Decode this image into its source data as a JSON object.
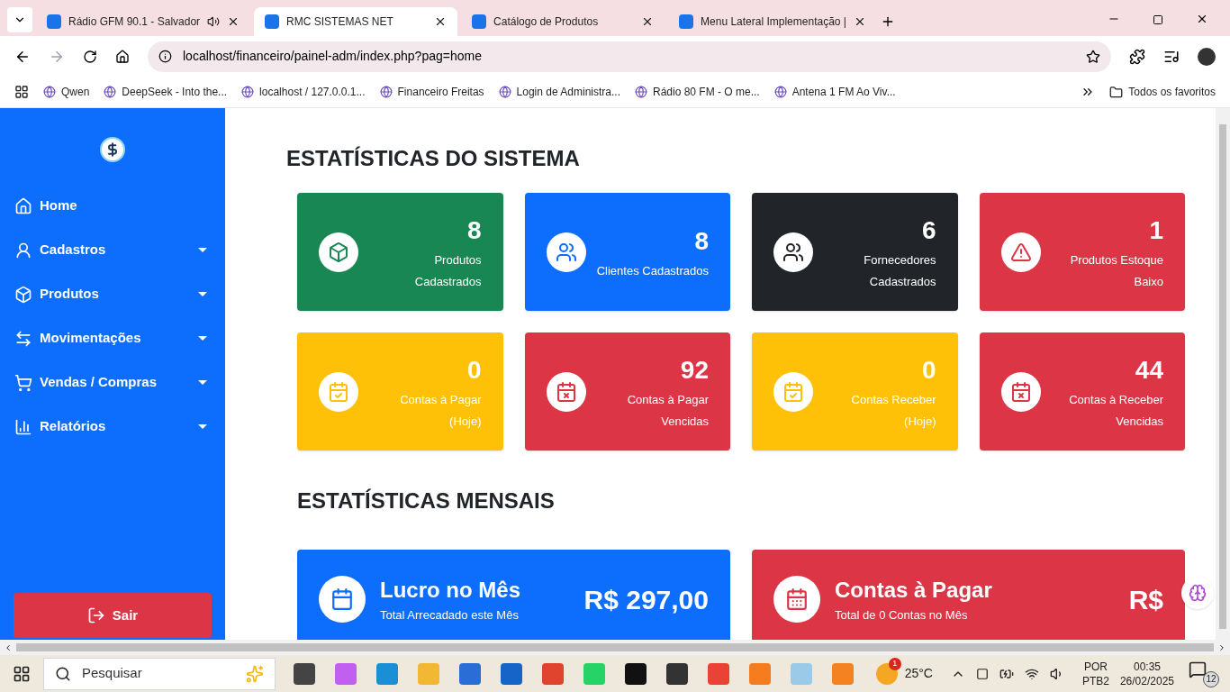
{
  "browser": {
    "tabs": [
      {
        "title": "Rádio GFM 90.1 - Salvador",
        "selected": false,
        "audio": true
      },
      {
        "title": "RMC SISTEMAS NET",
        "selected": true,
        "audio": false
      },
      {
        "title": "Catálogo de Produtos",
        "selected": false,
        "audio": false
      },
      {
        "title": "Menu Lateral Implementação |",
        "selected": false,
        "audio": false
      }
    ],
    "address": "localhost/financeiro/painel-adm/index.php?pag=home",
    "bookmarks": [
      "Qwen",
      "DeepSeek - Into the...",
      "localhost / 127.0.0.1...",
      "Financeiro Freitas",
      "Login de Administra...",
      "Rádio 80 FM - O me...",
      "Antena 1 FM Ao Viv..."
    ],
    "all_bookmarks": "Todos os favoritos"
  },
  "sidebar": {
    "items": [
      {
        "label": "Home",
        "kind": "home",
        "has_submenu": false
      },
      {
        "label": "Cadastros",
        "kind": "users",
        "has_submenu": true
      },
      {
        "label": "Produtos",
        "kind": "box",
        "has_submenu": true
      },
      {
        "label": "Movimentações",
        "kind": "arrows",
        "has_submenu": true
      },
      {
        "label": "Vendas / Compras",
        "kind": "cart",
        "has_submenu": true
      },
      {
        "label": "Relatórios",
        "kind": "chart",
        "has_submenu": true
      }
    ],
    "logout": "Sair"
  },
  "stats": {
    "title": "ESTATÍSTICAS DO SISTEMA",
    "cards": [
      {
        "value": "8",
        "label": "Produtos Cadastrados",
        "color": "#198754",
        "kind": "box"
      },
      {
        "value": "8",
        "label": "Clientes Cadastrados",
        "color": "#0d6efd",
        "kind": "users"
      },
      {
        "value": "6",
        "label": "Fornecedores Cadastrados",
        "color": "#212529",
        "kind": "users"
      },
      {
        "value": "1",
        "label": "Produtos Estoque Baixo",
        "color": "#dc3545",
        "kind": "alert"
      },
      {
        "value": "0",
        "label": "Contas à Pagar (Hoje)",
        "color": "#ffc107",
        "kind": "calendar-check"
      },
      {
        "value": "92",
        "label": "Contas à Pagar Vencidas",
        "color": "#dc3545",
        "kind": "calendar-x"
      },
      {
        "value": "0",
        "label": "Contas Receber (Hoje)",
        "color": "#ffc107",
        "kind": "calendar-check"
      },
      {
        "value": "44",
        "label": "Contas à Receber Vencidas",
        "color": "#dc3545",
        "kind": "calendar-x"
      }
    ]
  },
  "monthly": {
    "title": "ESTATÍSTICAS MENSAIS",
    "cards": [
      {
        "title": "Lucro no Mês",
        "subtitle": "Total Arrecadado este Mês",
        "value": "R$ 297,00",
        "color": "#0d6efd",
        "kind": "calendar"
      },
      {
        "title": "Contas à Pagar",
        "subtitle": "Total de 0 Contas no Mês",
        "value": "R$",
        "color": "#dc3545",
        "kind": "calendar-dots"
      }
    ]
  },
  "taskbar": {
    "search_placeholder": "Pesquisar",
    "weather_badge": "1",
    "temperature": "25°C",
    "language": "POR",
    "layout": "PTB2",
    "time": "00:35",
    "date": "26/02/2025",
    "notifications": "12"
  }
}
